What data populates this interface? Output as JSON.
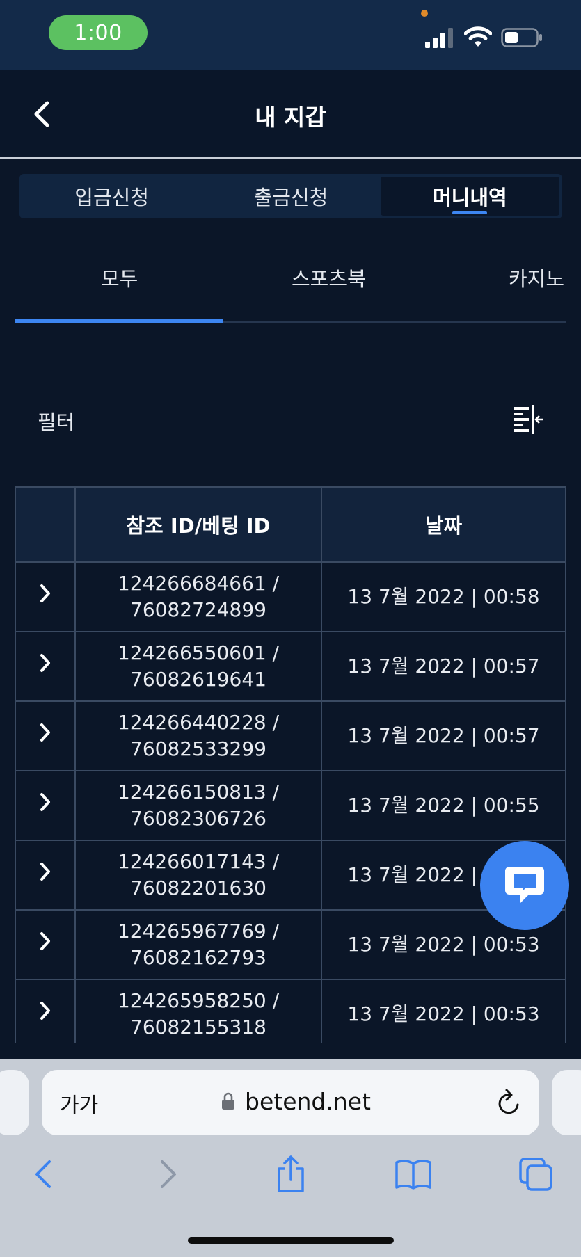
{
  "status_bar": {
    "time": "1:00"
  },
  "header": {
    "title": "내 지갑"
  },
  "segment_tabs": [
    "입금신청",
    "출금신청",
    "머니내역"
  ],
  "active_segment": 2,
  "sub_tabs": [
    "모두",
    "스포츠북",
    "카지노"
  ],
  "active_sub_tab": 0,
  "filter": {
    "label": "필터"
  },
  "table": {
    "headers": [
      "참조 ID/베팅 ID",
      "날짜"
    ],
    "rows": [
      {
        "ref_id": "124266684661 /",
        "bet_id": "76082724899",
        "date": "13 7월 2022 | 00:58"
      },
      {
        "ref_id": "124266550601 /",
        "bet_id": "76082619641",
        "date": "13 7월 2022 | 00:57"
      },
      {
        "ref_id": "124266440228 /",
        "bet_id": "76082533299",
        "date": "13 7월 2022 | 00:57"
      },
      {
        "ref_id": "124266150813 /",
        "bet_id": "76082306726",
        "date": "13 7월 2022 | 00:55"
      },
      {
        "ref_id": "124266017143 /",
        "bet_id": "76082201630",
        "date": "13 7월 2022 | 00:54"
      },
      {
        "ref_id": "124265967769 /",
        "bet_id": "76082162793",
        "date": "13 7월 2022 | 00:53"
      },
      {
        "ref_id": "124265958250 /",
        "bet_id": "76082155318",
        "date": "13 7월 2022 | 00:53"
      }
    ]
  },
  "browser": {
    "text_size_label": "가가",
    "url": "betend.net"
  },
  "colors": {
    "accent": "#3b82f0",
    "background": "#0b1628",
    "status_bar": "#132a49",
    "time_pill": "#5cc161"
  },
  "icons": [
    "back-chevron-icon",
    "filter-icon",
    "row-expand-chevron-icon",
    "chat-icon",
    "lock-icon",
    "reload-icon",
    "back-arrow-icon",
    "forward-arrow-icon",
    "share-icon",
    "bookmarks-icon",
    "tabs-icon"
  ]
}
